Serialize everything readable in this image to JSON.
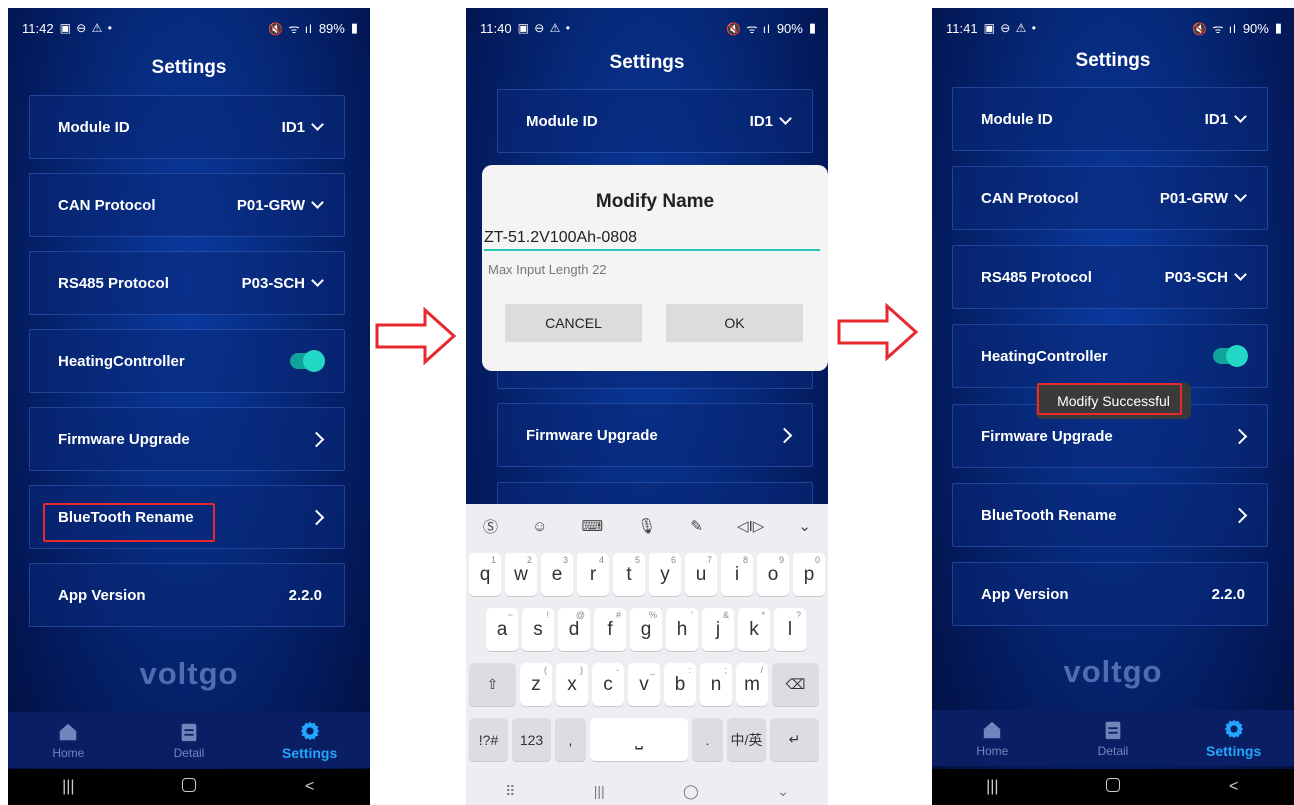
{
  "phone1": {
    "status_time": "11:42",
    "status_battery": "89%",
    "title": "Settings",
    "rows": {
      "module_id": {
        "label": "Module ID",
        "value": "ID1"
      },
      "can_protocol": {
        "label": "CAN Protocol",
        "value": "P01-GRW"
      },
      "rs485_protocol": {
        "label": "RS485 Protocol",
        "value": "P03-SCH"
      },
      "heating_controller": {
        "label": "HeatingController",
        "enabled": true
      },
      "firmware_upgrade": {
        "label": "Firmware Upgrade"
      },
      "bluetooth_rename": {
        "label": "BlueTooth Rename"
      },
      "app_version": {
        "label": "App Version",
        "value": "2.2.0"
      }
    },
    "brand": "voltgo",
    "tabs": {
      "home": "Home",
      "detail": "Detail",
      "settings": "Settings",
      "active": "settings"
    }
  },
  "phone2": {
    "status_time": "11:40",
    "status_battery": "90%",
    "title": "Settings",
    "rows": {
      "module_id": {
        "label": "Module ID",
        "value": "ID1"
      },
      "firmware_upgrade": {
        "label": "Firmware Upgrade"
      }
    },
    "dialog": {
      "title": "Modify Name",
      "input_value": "ZT-51.2V100Ah-0808",
      "hint": "Max Input Length 22",
      "cancel": "CANCEL",
      "ok": "OK"
    },
    "keyboard": {
      "row1": [
        {
          "k": "q",
          "h": "1"
        },
        {
          "k": "w",
          "h": "2"
        },
        {
          "k": "e",
          "h": "3"
        },
        {
          "k": "r",
          "h": "4"
        },
        {
          "k": "t",
          "h": "5"
        },
        {
          "k": "y",
          "h": "6"
        },
        {
          "k": "u",
          "h": "7"
        },
        {
          "k": "i",
          "h": "8"
        },
        {
          "k": "o",
          "h": "9"
        },
        {
          "k": "p",
          "h": "0"
        }
      ],
      "row2": [
        {
          "k": "a",
          "h": "~"
        },
        {
          "k": "s",
          "h": "!"
        },
        {
          "k": "d",
          "h": "@"
        },
        {
          "k": "f",
          "h": "#"
        },
        {
          "k": "g",
          "h": "%"
        },
        {
          "k": "h",
          "h": "'"
        },
        {
          "k": "j",
          "h": "&"
        },
        {
          "k": "k",
          "h": "*"
        },
        {
          "k": "l",
          "h": "?"
        }
      ],
      "row3": [
        {
          "k": "z",
          "h": "("
        },
        {
          "k": "x",
          "h": ")"
        },
        {
          "k": "c",
          "h": "-"
        },
        {
          "k": "v",
          "h": "_"
        },
        {
          "k": "b",
          "h": ":"
        },
        {
          "k": "n",
          "h": ";"
        },
        {
          "k": "m",
          "h": "/"
        }
      ],
      "sym": "!?#",
      "num": "123",
      "comma": ",",
      "period": ".",
      "lang": "中/英"
    }
  },
  "phone3": {
    "status_time": "11:41",
    "status_battery": "90%",
    "title": "Settings",
    "rows": {
      "module_id": {
        "label": "Module ID",
        "value": "ID1"
      },
      "can_protocol": {
        "label": "CAN Protocol",
        "value": "P01-GRW"
      },
      "rs485_protocol": {
        "label": "RS485 Protocol",
        "value": "P03-SCH"
      },
      "heating_controller": {
        "label": "HeatingController",
        "enabled": true
      },
      "firmware_upgrade": {
        "label": "Firmware Upgrade"
      },
      "bluetooth_rename": {
        "label": "BlueTooth Rename"
      },
      "app_version": {
        "label": "App Version",
        "value": "2.2.0"
      }
    },
    "toast": "Modify Successful",
    "brand": "voltgo",
    "tabs": {
      "home": "Home",
      "detail": "Detail",
      "settings": "Settings",
      "active": "settings"
    }
  },
  "colors": {
    "accent": "#23a6ff",
    "toggle": "#22d8c4",
    "highlight": "#e8282d",
    "arrow": "#e8282d"
  }
}
